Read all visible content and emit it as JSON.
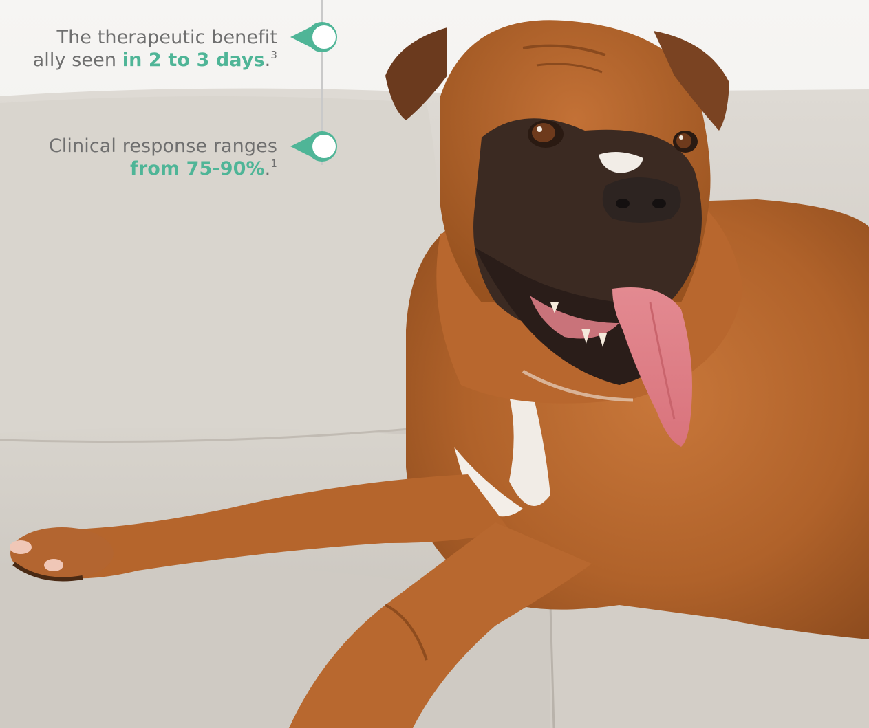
{
  "callouts": [
    {
      "line1": "The therapeutic benefit",
      "line2_prefix": "ally seen ",
      "highlight": "in 2 to 3 days",
      "suffix": ".",
      "ref": "3"
    },
    {
      "line1": "Clinical response ranges",
      "line2_prefix": "",
      "highlight": "from 75-90%",
      "suffix": ".",
      "ref": "1"
    }
  ],
  "colors": {
    "accent": "#4fb597",
    "accent_dark": "#3a9a7e",
    "body_text": "#6f6f6f",
    "timeline_line": "#c9c9c9",
    "background": "#f2f1ef",
    "sofa": "#d7d3cc",
    "dog_fur": "#b8692e"
  },
  "image": {
    "subject": "boxer dog lying on light grey sofa with tongue out"
  }
}
